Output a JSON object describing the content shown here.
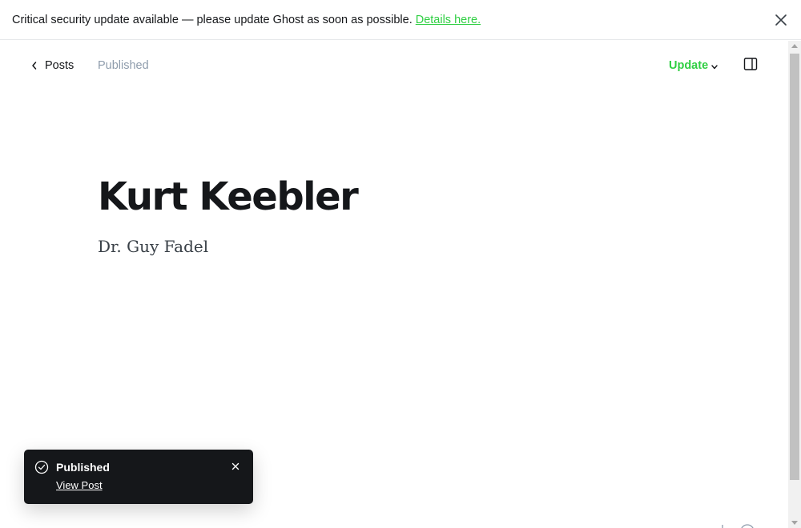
{
  "banner": {
    "message": "Critical security update available — please update Ghost as soon as possible.",
    "link_label": "Details here."
  },
  "header": {
    "back_label": "Posts",
    "status": "Published",
    "update_label": "Update"
  },
  "post": {
    "title": "Kurt Keebler",
    "body": "Dr. Guy Fadel"
  },
  "toast": {
    "title": "Published",
    "action_label": "View Post"
  },
  "colors": {
    "accent_green": "#30cf43",
    "text_dark": "#15171a",
    "text_muted": "#8e9cac",
    "toast_bg": "#15171a"
  },
  "icons": {
    "banner_close": "close-icon",
    "back": "chevron-left-icon",
    "update_dropdown": "chevron-down-icon",
    "sidebar_toggle": "sidebar-toggle-icon",
    "toast_status": "check-circle-icon",
    "toast_close": "close-icon"
  }
}
